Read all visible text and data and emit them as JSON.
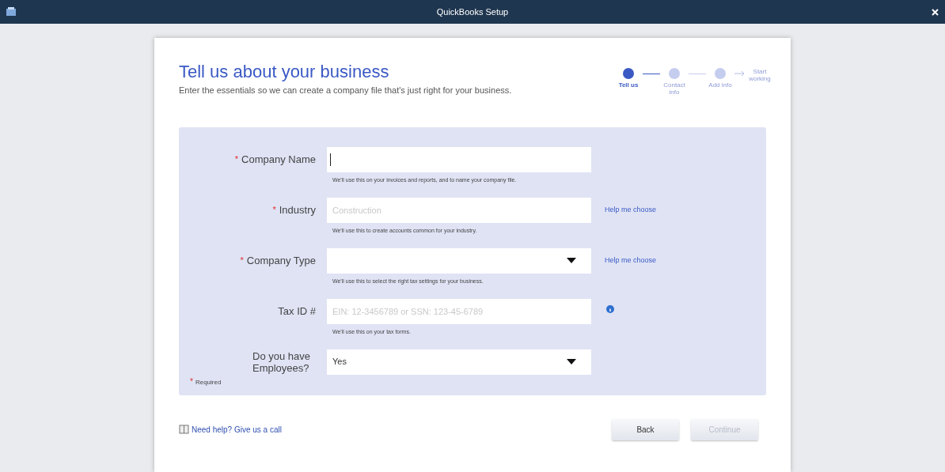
{
  "window": {
    "title": "QuickBooks Setup"
  },
  "header": {
    "title": "Tell us about your business",
    "subtitle": "Enter the essentials so we can create a company file that's just right for your business."
  },
  "steps": [
    {
      "label": "Tell us",
      "kind": "circle",
      "selected": true
    },
    {
      "label": "Contact info",
      "kind": "circle",
      "selected": false
    },
    {
      "label": "Add info",
      "kind": "circle",
      "selected": false
    },
    {
      "label": "Start working",
      "kind": "arrow",
      "selected": false
    }
  ],
  "fields": [
    {
      "label": "Company Name",
      "required": true,
      "kind": "text",
      "focused": true,
      "help": "We'll use this on your invoices and reports, and to name your company file."
    },
    {
      "label": "Industry",
      "required": true,
      "kind": "text",
      "placeholder": "Construction",
      "help": "We'll use this to create accounts common for your industry.",
      "side": {
        "kind": "link",
        "text": "Help me choose"
      }
    },
    {
      "label": "Company Type",
      "required": true,
      "kind": "select",
      "help": "We'll use this to select the right tax settings for your business.",
      "side": {
        "kind": "link",
        "text": "Help me choose"
      }
    },
    {
      "label": "Tax ID #",
      "required": false,
      "kind": "text",
      "placeholder": "EIN: 12-3456789 or SSN: 123-45-6789",
      "help": "We'll use this on your tax forms.",
      "side": {
        "kind": "info"
      }
    },
    {
      "label": "Do you have Employees?",
      "required": false,
      "kind": "select",
      "value": "Yes"
    }
  ],
  "required_mark": "*",
  "required_note": "Required",
  "help_link": "Need help? Give us a call",
  "buttons": [
    {
      "label": "Back",
      "disabled": false
    },
    {
      "label": "Continue",
      "disabled": true
    }
  ]
}
